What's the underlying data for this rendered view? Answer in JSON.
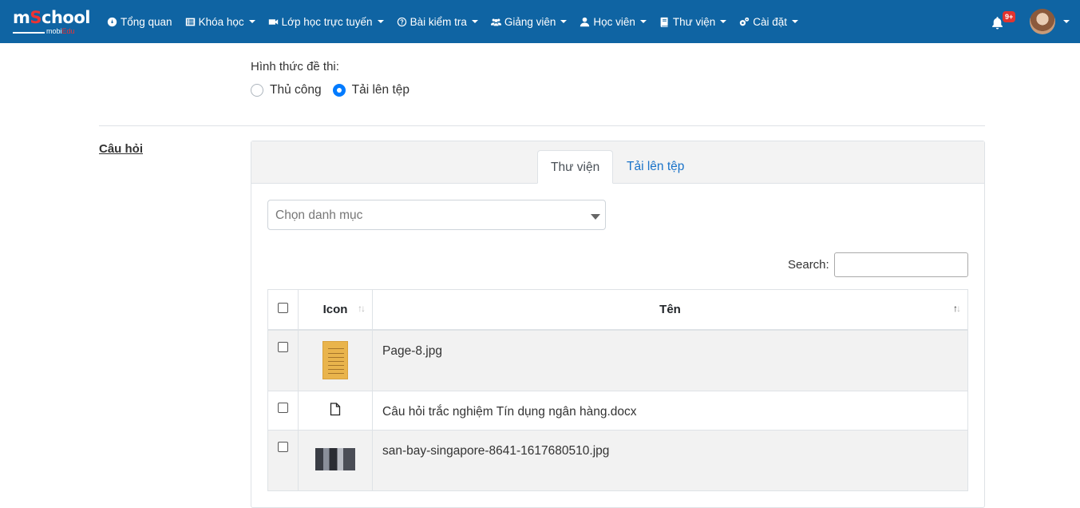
{
  "brand": {
    "main_a": "m",
    "main_s": "S",
    "main_b": "chool",
    "sub_a": "mobi",
    "sub_b": "Edu"
  },
  "nav": [
    {
      "label": "Tổng quan",
      "icon": "dashboard-icon",
      "has_caret": false
    },
    {
      "label": "Khóa học",
      "icon": "list-icon",
      "has_caret": true
    },
    {
      "label": "Lớp học trực tuyến",
      "icon": "video-icon",
      "has_caret": true
    },
    {
      "label": "Bài kiểm tra",
      "icon": "question-circle-icon",
      "has_caret": true
    },
    {
      "label": "Giảng viên",
      "icon": "users-icon",
      "has_caret": true
    },
    {
      "label": "Học viên",
      "icon": "user-icon",
      "has_caret": true
    },
    {
      "label": "Thư viện",
      "icon": "book-icon",
      "has_caret": true
    },
    {
      "label": "Cài đặt",
      "icon": "cogs-icon",
      "has_caret": true
    }
  ],
  "notifications": {
    "badge": "9+"
  },
  "form": {
    "exam_type_label": "Hình thức đề thi:",
    "options": [
      {
        "label": "Thủ công",
        "checked": false
      },
      {
        "label": "Tải lên tệp",
        "checked": true
      }
    ]
  },
  "section": {
    "label": "Câu hỏi"
  },
  "tabs": {
    "library": "Thư viện",
    "upload": "Tải lên tệp"
  },
  "category_select": {
    "placeholder": "Chọn danh mục"
  },
  "search": {
    "label": "Search:",
    "value": ""
  },
  "table": {
    "headers": {
      "icon": "Icon",
      "name": "Tên"
    },
    "rows": [
      {
        "name": "Page-8.jpg",
        "thumb": "document-image"
      },
      {
        "name": "Câu hỏi trắc nghiệm Tín dụng ngân hàng.docx",
        "thumb": "file-icon"
      },
      {
        "name": "san-bay-singapore-8641-1617680510.jpg",
        "thumb": "photo-image"
      }
    ]
  },
  "colors": {
    "navbar": "#0f64a3",
    "accent": "#007bff",
    "link": "#1a73c9",
    "badge": "#e3342f"
  }
}
